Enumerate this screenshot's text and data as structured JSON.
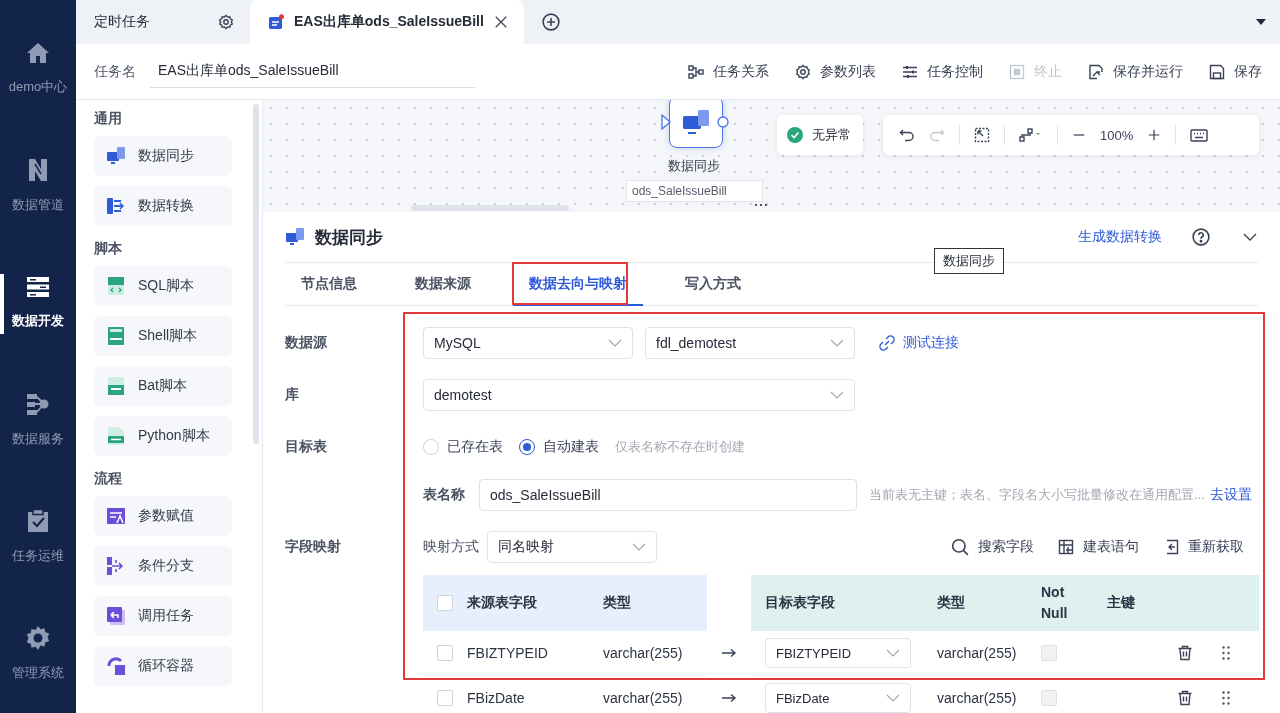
{
  "nav": [
    {
      "label": "demo中心",
      "selected": false
    },
    {
      "label": "数据管道",
      "selected": false
    },
    {
      "label": "数据开发",
      "selected": true
    },
    {
      "label": "数据服务",
      "selected": false
    },
    {
      "label": "任务运维",
      "selected": false
    },
    {
      "label": "管理系统",
      "selected": false
    }
  ],
  "tabs": [
    {
      "label": "定时任务",
      "selected": false,
      "kind": "settings"
    },
    {
      "label": "EAS出库单ods_SaleIssueBill",
      "selected": true,
      "kind": "closable"
    }
  ],
  "task_name": {
    "label": "任务名",
    "value": "EAS出库单ods_SaleIssueBill"
  },
  "toolbar": [
    {
      "label": "任务关系",
      "disabled": false
    },
    {
      "label": "参数列表",
      "disabled": false
    },
    {
      "label": "任务控制",
      "disabled": false
    },
    {
      "label": "终止",
      "disabled": true
    },
    {
      "label": "保存并运行",
      "disabled": false
    },
    {
      "label": "保存",
      "disabled": false
    }
  ],
  "palette": [
    {
      "title": "通用",
      "items": [
        "数据同步",
        "数据转换"
      ]
    },
    {
      "title": "脚本",
      "items": [
        "SQL脚本",
        "Shell脚本",
        "Bat脚本",
        "Python脚本"
      ]
    },
    {
      "title": "流程",
      "items": [
        "参数赋值",
        "条件分支",
        "调用任务",
        "循环容器"
      ]
    }
  ],
  "canvas": {
    "node_label": "数据同步",
    "node_name": "ods_SaleIssueBill",
    "status": "无异常",
    "zoom": "100%"
  },
  "tooltip": "数据同步",
  "panel": {
    "title": "数据同步",
    "action": "生成数据转换",
    "tabs": [
      {
        "label": "节点信息",
        "selected": false
      },
      {
        "label": "数据来源",
        "selected": false
      },
      {
        "label": "数据去向与映射",
        "selected": true
      },
      {
        "label": "写入方式",
        "selected": false
      }
    ],
    "datasource": {
      "label": "数据源",
      "type": "MySQL",
      "connection": "fdl_demotest",
      "test": "测试连接"
    },
    "database": {
      "label": "库",
      "value": "demotest"
    },
    "target": {
      "label": "目标表",
      "options": [
        {
          "label": "已存在表",
          "selected": false
        },
        {
          "label": "自动建表",
          "selected": true
        }
      ],
      "hint": "仅表名称不存在时创建"
    },
    "table_name": {
      "label": "表名称",
      "value": "ods_SaleIssueBill",
      "hint": "当前表无主键；表名、字段名大小写批量修改在通用配置...",
      "link": "去设置"
    },
    "mapping": {
      "label": "字段映射",
      "mode_label": "映射方式",
      "mode": "同名映射",
      "actions": [
        "搜索字段",
        "建表语句",
        "重新获取"
      ]
    },
    "table": {
      "header_checked": false,
      "source_columns": [
        "来源表字段",
        "类型"
      ],
      "target_columns": [
        "目标表字段",
        "类型",
        "Not Null",
        "主键"
      ],
      "rows": [
        {
          "checked": false,
          "source": "FBIZTYPEID",
          "source_type": "varchar(255)",
          "target": "FBIZTYPEID",
          "target_type": "varchar(255)",
          "not_null": false
        },
        {
          "checked": false,
          "source": "FBizDate",
          "source_type": "varchar(255)",
          "target": "FBizDate",
          "target_type": "varchar(255)",
          "not_null": false
        }
      ]
    }
  }
}
